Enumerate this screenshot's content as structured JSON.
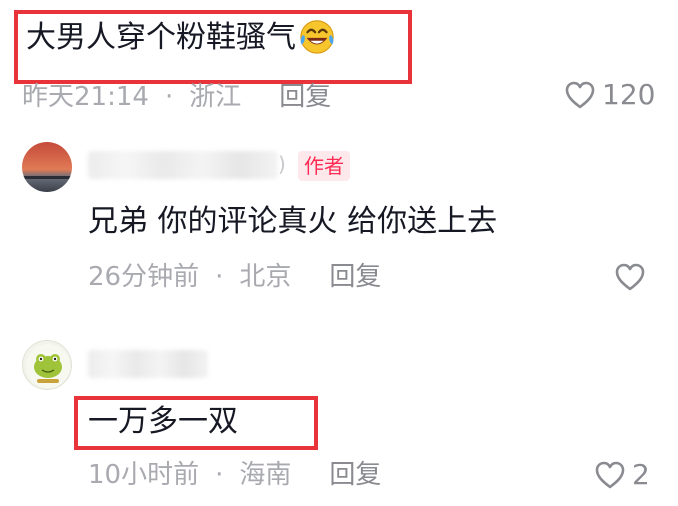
{
  "comments": [
    {
      "text": "大男人穿个粉鞋骚气",
      "emoji": "laughing-tears-emoji",
      "time": "昨天21:14",
      "location": "浙江",
      "reply_label": "回复",
      "likes": "120"
    },
    {
      "badge": "作者",
      "text": "兄弟 你的评论真火 给你送上去",
      "time": "26分钟前",
      "location": "北京",
      "reply_label": "回复",
      "likes": ""
    },
    {
      "text": "一万多一双",
      "time": "10小时前",
      "location": "海南",
      "reply_label": "回复",
      "likes": "2"
    }
  ],
  "separator": "·",
  "colors": {
    "highlight_box": "#e8333a",
    "author_badge_text": "#fe2c55",
    "author_badge_bg": "#fde9ec",
    "meta_text": "#a9aab0"
  },
  "icons": [
    "heart-outline-icon"
  ]
}
